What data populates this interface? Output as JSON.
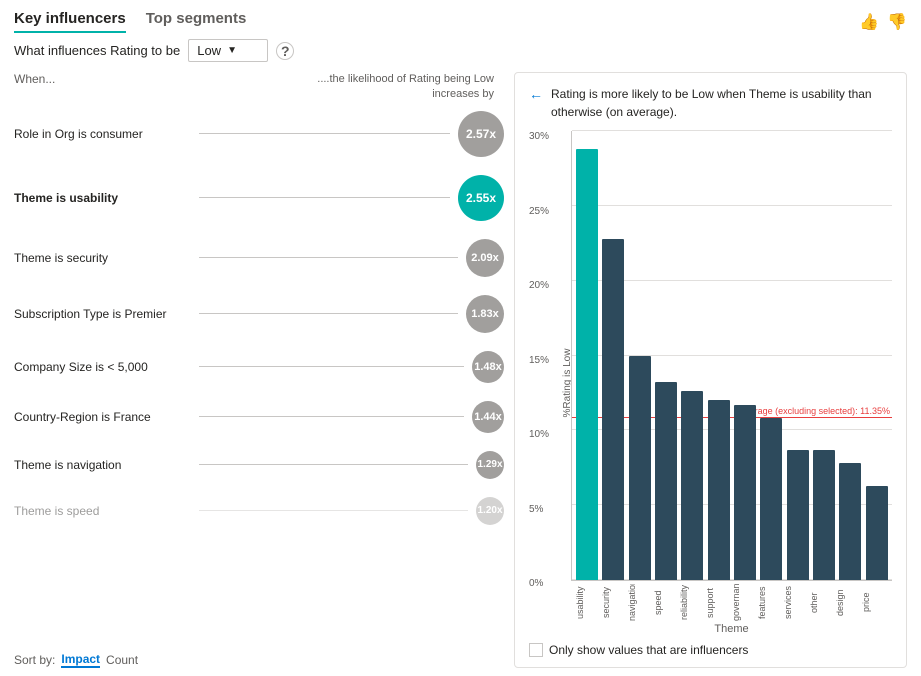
{
  "tabs": {
    "items": [
      {
        "label": "Key influencers",
        "active": true
      },
      {
        "label": "Top segments",
        "active": false
      }
    ]
  },
  "filter": {
    "question": "What influences Rating to be",
    "value": "Low",
    "help": "?"
  },
  "left": {
    "when_label": "When...",
    "likelihood_label": "....the likelihood of Rating being Low increases by",
    "rows": [
      {
        "label": "Role in Org is consumer",
        "value": "2.57x",
        "active": false,
        "size": "md"
      },
      {
        "label": "Theme is usability",
        "value": "2.55x",
        "active": true,
        "size": "md"
      },
      {
        "label": "Theme is security",
        "value": "2.09x",
        "active": false,
        "size": "sm"
      },
      {
        "label": "Subscription Type is Premier",
        "value": "1.83x",
        "active": false,
        "size": "sm"
      },
      {
        "label": "Company Size is < 5,000",
        "value": "1.48x",
        "active": false,
        "size": "xs"
      },
      {
        "label": "Country-Region is France",
        "value": "1.44x",
        "active": false,
        "size": "xs"
      },
      {
        "label": "Theme is navigation",
        "value": "1.29x",
        "active": false,
        "size": "xxs"
      },
      {
        "label": "Theme is speed",
        "value": "1.20x",
        "active": false,
        "size": "xxs",
        "faded": true
      }
    ],
    "sort_label": "Sort by:",
    "sort_impact": "Impact",
    "sort_count": "Count"
  },
  "right": {
    "title": "Rating is more likely to be Low when Theme is usability than otherwise (on average).",
    "y_axis_labels": [
      "30%",
      "25%",
      "20%",
      "15%",
      "10%",
      "5%",
      "0%"
    ],
    "y_axis_title": "%Rating is Low",
    "x_axis_title": "Theme",
    "avg_label": "Average (excluding selected): 11.35%",
    "bars": [
      {
        "label": "usability",
        "height_pct": 96,
        "teal": true
      },
      {
        "label": "security",
        "height_pct": 76
      },
      {
        "label": "navigation",
        "height_pct": 50
      },
      {
        "label": "speed",
        "height_pct": 44
      },
      {
        "label": "reliability",
        "height_pct": 42
      },
      {
        "label": "support",
        "height_pct": 40
      },
      {
        "label": "governance",
        "height_pct": 39
      },
      {
        "label": "features",
        "height_pct": 36
      },
      {
        "label": "services",
        "height_pct": 29
      },
      {
        "label": "other",
        "height_pct": 29
      },
      {
        "label": "design",
        "height_pct": 26
      },
      {
        "label": "price",
        "height_pct": 21
      }
    ],
    "avg_line_pct": 36,
    "checkbox_label": "Only show values that are influencers"
  }
}
